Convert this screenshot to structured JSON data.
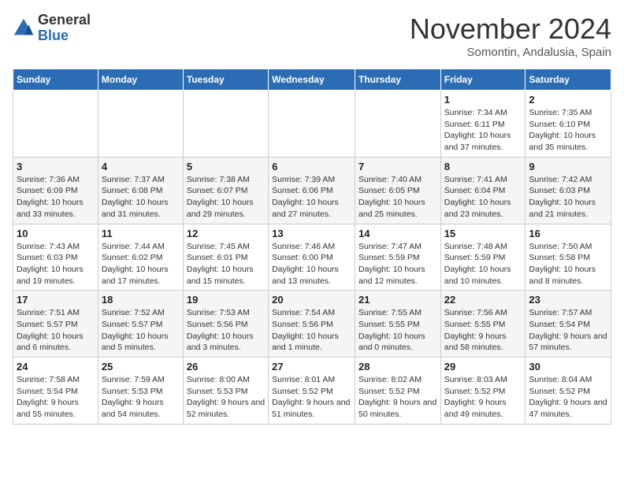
{
  "logo": {
    "general": "General",
    "blue": "Blue"
  },
  "title": "November 2024",
  "subtitle": "Somontin, Andalusia, Spain",
  "days_of_week": [
    "Sunday",
    "Monday",
    "Tuesday",
    "Wednesday",
    "Thursday",
    "Friday",
    "Saturday"
  ],
  "weeks": [
    [
      {
        "day": "",
        "info": ""
      },
      {
        "day": "",
        "info": ""
      },
      {
        "day": "",
        "info": ""
      },
      {
        "day": "",
        "info": ""
      },
      {
        "day": "",
        "info": ""
      },
      {
        "day": "1",
        "info": "Sunrise: 7:34 AM\nSunset: 6:11 PM\nDaylight: 10 hours and 37 minutes."
      },
      {
        "day": "2",
        "info": "Sunrise: 7:35 AM\nSunset: 6:10 PM\nDaylight: 10 hours and 35 minutes."
      }
    ],
    [
      {
        "day": "3",
        "info": "Sunrise: 7:36 AM\nSunset: 6:09 PM\nDaylight: 10 hours and 33 minutes."
      },
      {
        "day": "4",
        "info": "Sunrise: 7:37 AM\nSunset: 6:08 PM\nDaylight: 10 hours and 31 minutes."
      },
      {
        "day": "5",
        "info": "Sunrise: 7:38 AM\nSunset: 6:07 PM\nDaylight: 10 hours and 29 minutes."
      },
      {
        "day": "6",
        "info": "Sunrise: 7:39 AM\nSunset: 6:06 PM\nDaylight: 10 hours and 27 minutes."
      },
      {
        "day": "7",
        "info": "Sunrise: 7:40 AM\nSunset: 6:05 PM\nDaylight: 10 hours and 25 minutes."
      },
      {
        "day": "8",
        "info": "Sunrise: 7:41 AM\nSunset: 6:04 PM\nDaylight: 10 hours and 23 minutes."
      },
      {
        "day": "9",
        "info": "Sunrise: 7:42 AM\nSunset: 6:03 PM\nDaylight: 10 hours and 21 minutes."
      }
    ],
    [
      {
        "day": "10",
        "info": "Sunrise: 7:43 AM\nSunset: 6:03 PM\nDaylight: 10 hours and 19 minutes."
      },
      {
        "day": "11",
        "info": "Sunrise: 7:44 AM\nSunset: 6:02 PM\nDaylight: 10 hours and 17 minutes."
      },
      {
        "day": "12",
        "info": "Sunrise: 7:45 AM\nSunset: 6:01 PM\nDaylight: 10 hours and 15 minutes."
      },
      {
        "day": "13",
        "info": "Sunrise: 7:46 AM\nSunset: 6:00 PM\nDaylight: 10 hours and 13 minutes."
      },
      {
        "day": "14",
        "info": "Sunrise: 7:47 AM\nSunset: 5:59 PM\nDaylight: 10 hours and 12 minutes."
      },
      {
        "day": "15",
        "info": "Sunrise: 7:48 AM\nSunset: 5:59 PM\nDaylight: 10 hours and 10 minutes."
      },
      {
        "day": "16",
        "info": "Sunrise: 7:50 AM\nSunset: 5:58 PM\nDaylight: 10 hours and 8 minutes."
      }
    ],
    [
      {
        "day": "17",
        "info": "Sunrise: 7:51 AM\nSunset: 5:57 PM\nDaylight: 10 hours and 6 minutes."
      },
      {
        "day": "18",
        "info": "Sunrise: 7:52 AM\nSunset: 5:57 PM\nDaylight: 10 hours and 5 minutes."
      },
      {
        "day": "19",
        "info": "Sunrise: 7:53 AM\nSunset: 5:56 PM\nDaylight: 10 hours and 3 minutes."
      },
      {
        "day": "20",
        "info": "Sunrise: 7:54 AM\nSunset: 5:56 PM\nDaylight: 10 hours and 1 minute."
      },
      {
        "day": "21",
        "info": "Sunrise: 7:55 AM\nSunset: 5:55 PM\nDaylight: 10 hours and 0 minutes."
      },
      {
        "day": "22",
        "info": "Sunrise: 7:56 AM\nSunset: 5:55 PM\nDaylight: 9 hours and 58 minutes."
      },
      {
        "day": "23",
        "info": "Sunrise: 7:57 AM\nSunset: 5:54 PM\nDaylight: 9 hours and 57 minutes."
      }
    ],
    [
      {
        "day": "24",
        "info": "Sunrise: 7:58 AM\nSunset: 5:54 PM\nDaylight: 9 hours and 55 minutes."
      },
      {
        "day": "25",
        "info": "Sunrise: 7:59 AM\nSunset: 5:53 PM\nDaylight: 9 hours and 54 minutes."
      },
      {
        "day": "26",
        "info": "Sunrise: 8:00 AM\nSunset: 5:53 PM\nDaylight: 9 hours and 52 minutes."
      },
      {
        "day": "27",
        "info": "Sunrise: 8:01 AM\nSunset: 5:52 PM\nDaylight: 9 hours and 51 minutes."
      },
      {
        "day": "28",
        "info": "Sunrise: 8:02 AM\nSunset: 5:52 PM\nDaylight: 9 hours and 50 minutes."
      },
      {
        "day": "29",
        "info": "Sunrise: 8:03 AM\nSunset: 5:52 PM\nDaylight: 9 hours and 49 minutes."
      },
      {
        "day": "30",
        "info": "Sunrise: 8:04 AM\nSunset: 5:52 PM\nDaylight: 9 hours and 47 minutes."
      }
    ]
  ]
}
